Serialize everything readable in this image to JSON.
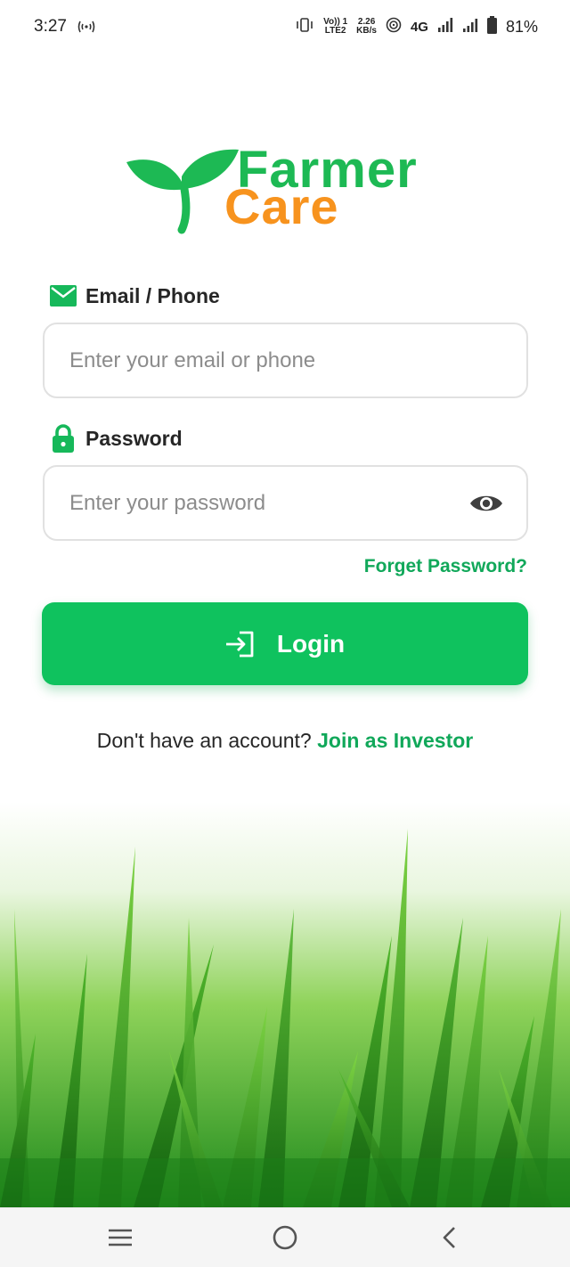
{
  "status_bar": {
    "time": "3:27",
    "volte_top": "Vo)) 1",
    "volte_bottom": "LTE2",
    "speed_value": "2.26",
    "speed_unit": "KB/s",
    "network": "4G",
    "battery": "81%"
  },
  "logo": {
    "word_1": "Farmer",
    "word_2": "Care",
    "leaf_color": "#1db954",
    "accent_color": "#f7931e"
  },
  "email_field": {
    "label": "Email / Phone",
    "placeholder": "Enter your email or phone",
    "value": "",
    "icon": "mail-icon"
  },
  "password_field": {
    "label": "Password",
    "placeholder": "Enter your password",
    "value": "",
    "icon": "lock-icon",
    "toggle_icon": "eye-icon"
  },
  "forget_password": "Forget Password?",
  "login_button": {
    "label": "Login",
    "icon": "login-arrow-icon",
    "color": "#0fc25e"
  },
  "signup": {
    "prompt": "Don't have an account?",
    "link": "Join as Investor"
  },
  "nav_bar": {
    "buttons": [
      "menu-icon",
      "home-circle-icon",
      "back-chevron-icon"
    ]
  }
}
